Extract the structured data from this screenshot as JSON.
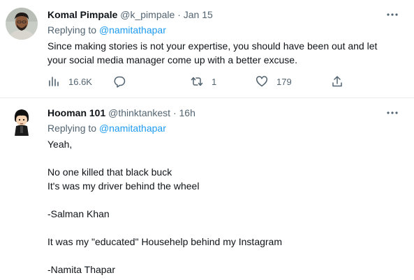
{
  "tweets": [
    {
      "display_name": "Komal Pimpale",
      "handle": "@k_pimpale",
      "separator": "·",
      "time": "Jan 15",
      "replying_prefix": "Replying to",
      "replying_to": "@namitathapar",
      "body": [
        "Since making stories is not your expertise, you should have been out and let",
        "your social media manager come up with a better excuse."
      ],
      "stats": {
        "views": "16.6K",
        "replies": "",
        "retweets": "1",
        "likes": "179"
      }
    },
    {
      "display_name": "Hooman 101",
      "handle": "@thinktankest",
      "separator": "·",
      "time": "16h",
      "replying_prefix": "Replying to",
      "replying_to": "@namitathapar",
      "body": [
        "Yeah,",
        "",
        "No one killed that black buck",
        "It's was my driver behind the wheel",
        "",
        "-Salman Khan",
        "",
        "It was my \"educated\" Househelp behind my Instagram",
        "",
        "-Namita Thapar"
      ]
    }
  ],
  "icons": {
    "more": "more-horizontal-icon",
    "views": "bar-chart-icon",
    "reply": "chat-bubble-icon",
    "retweet": "retweet-icon",
    "like": "heart-icon",
    "share": "share-upload-icon"
  },
  "colors": {
    "text": "#0f1419",
    "secondary": "#536471",
    "link": "#1d9bf0",
    "divider": "#e8ecee"
  }
}
